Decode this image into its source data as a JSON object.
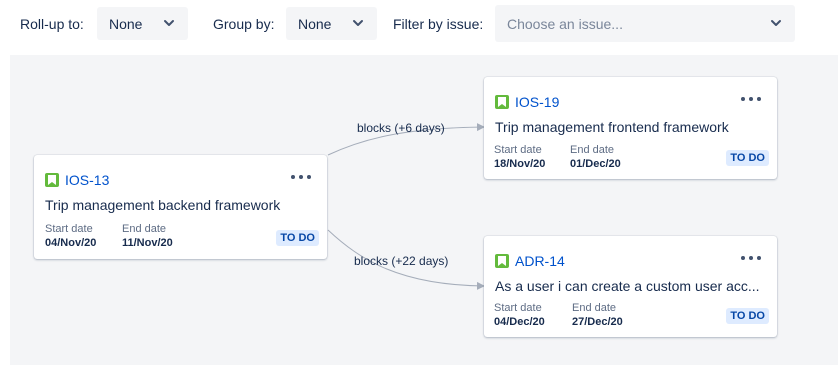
{
  "toolbar": {
    "rollup_label": "Roll-up to:",
    "rollup_value": "None",
    "groupby_label": "Group by:",
    "groupby_value": "None",
    "filter_label": "Filter by issue:",
    "filter_placeholder": "Choose an issue..."
  },
  "cards": [
    {
      "key": "IOS-13",
      "summary": "Trip management backend framework",
      "start_label": "Start date",
      "start_value": "04/Nov/20",
      "end_label": "End date",
      "end_value": "11/Nov/20",
      "status": "TO DO"
    },
    {
      "key": "IOS-19",
      "summary": "Trip management frontend framework",
      "start_label": "Start date",
      "start_value": "18/Nov/20",
      "end_label": "End date",
      "end_value": "01/Dec/20",
      "status": "TO DO"
    },
    {
      "key": "ADR-14",
      "summary": "As a user i can create a custom user acc...",
      "start_label": "Start date",
      "start_value": "04/Dec/20",
      "end_label": "End date",
      "end_value": "27/Dec/20",
      "status": "TO DO"
    }
  ],
  "links": [
    {
      "label": "blocks (+6 days)"
    },
    {
      "label": "blocks (+22 days)"
    }
  ],
  "colors": {
    "story_icon": "#63ba3c",
    "issue_key": "#0052cc",
    "status_bg": "#deebff",
    "status_text": "#0747a6",
    "canvas_bg": "#f4f5f7",
    "link_line": "#a5adba"
  },
  "icons": {
    "story": "bookmark-icon",
    "more": "more-actions-icon",
    "dropdown": "chevron-down-icon"
  }
}
